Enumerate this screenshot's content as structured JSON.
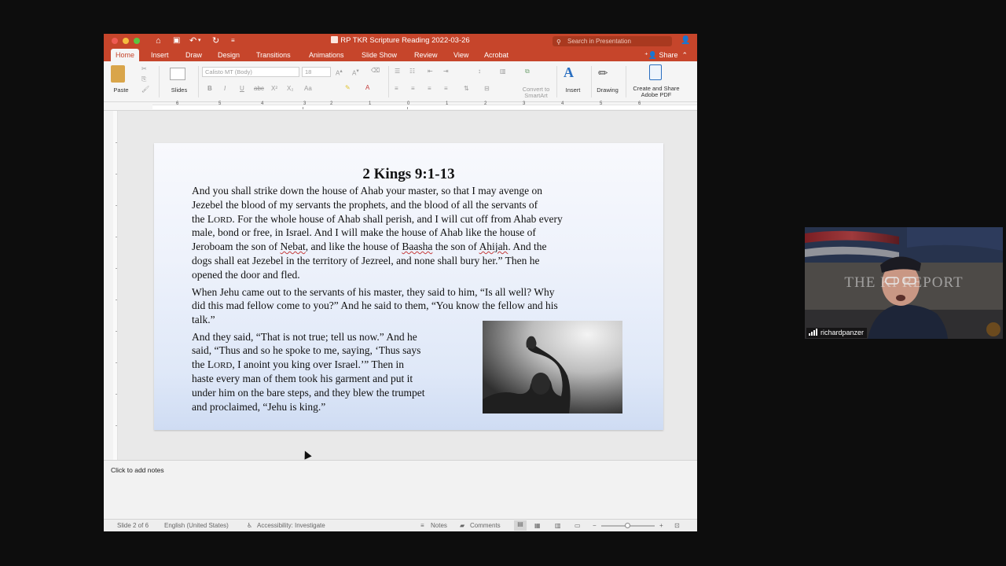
{
  "window": {
    "title": "RP TKR Scripture Reading 2022-03-26",
    "search_placeholder": "Search in Presentation",
    "share_label": "Share"
  },
  "tabs": [
    {
      "label": "Home",
      "active": true
    },
    {
      "label": "Insert"
    },
    {
      "label": "Draw"
    },
    {
      "label": "Design"
    },
    {
      "label": "Transitions"
    },
    {
      "label": "Animations"
    },
    {
      "label": "Slide Show"
    },
    {
      "label": "Review"
    },
    {
      "label": "View"
    },
    {
      "label": "Acrobat"
    }
  ],
  "ribbon": {
    "paste": "Paste",
    "slides": "Slides",
    "font_name": "Calisto MT (Body)",
    "font_size": "18",
    "convert_smartart": "Convert to SmartArt",
    "insert": "Insert",
    "drawing": "Drawing",
    "create_share_pdf": "Create and Share Adobe PDF"
  },
  "ruler": {
    "numbers": [
      "6",
      "5",
      "4",
      "3",
      "2",
      "1",
      "0",
      "1",
      "2",
      "3",
      "4",
      "5",
      "6"
    ]
  },
  "slide": {
    "title": "2 Kings 9:1-13",
    "p1": [
      "And you shall strike down the house of Ahab your master, so that I may avenge on",
      "Jezebel the blood of my servants the prophets, and the blood of all the servants of",
      "the LORD.  For the whole house of Ahab shall perish, and I will cut off from Ahab every",
      "male, bond or free, in Israel. And I will make the house of Ahab like the house of",
      "Jeroboam the son of Nebat, and like the house of Baasha the son of Ahijah.  And the",
      "dogs shall eat Jezebel in the territory of Jezreel, and none shall bury her.” Then he",
      "opened the door and fled."
    ],
    "p2": [
      "When Jehu came out to the servants of his master, they said to him, “Is all well? Why",
      "did this mad fellow come to you?” And he said to them, “You know the fellow and his",
      "talk.”"
    ],
    "p3": [
      "And they said, “That is not true; tell us now.” And he",
      "said, “Thus and so he spoke to me, saying, ‘Thus says",
      "the LORD, I anoint you king over Israel.’” Then in",
      "haste every man of them took his garment and put it",
      "under him on the bare steps, and they blew the trumpet",
      "and proclaimed, “Jehu is king.”"
    ]
  },
  "notes": {
    "placeholder": "Click to add notes"
  },
  "statusbar": {
    "slide_count": "Slide 2 of 6",
    "language": "English (United States)",
    "accessibility": "Accessibility: Investigate",
    "notes": "Notes",
    "comments": "Comments"
  },
  "video": {
    "participant_name": "richardpanzer",
    "watermark": "THE KI      REPORT"
  }
}
